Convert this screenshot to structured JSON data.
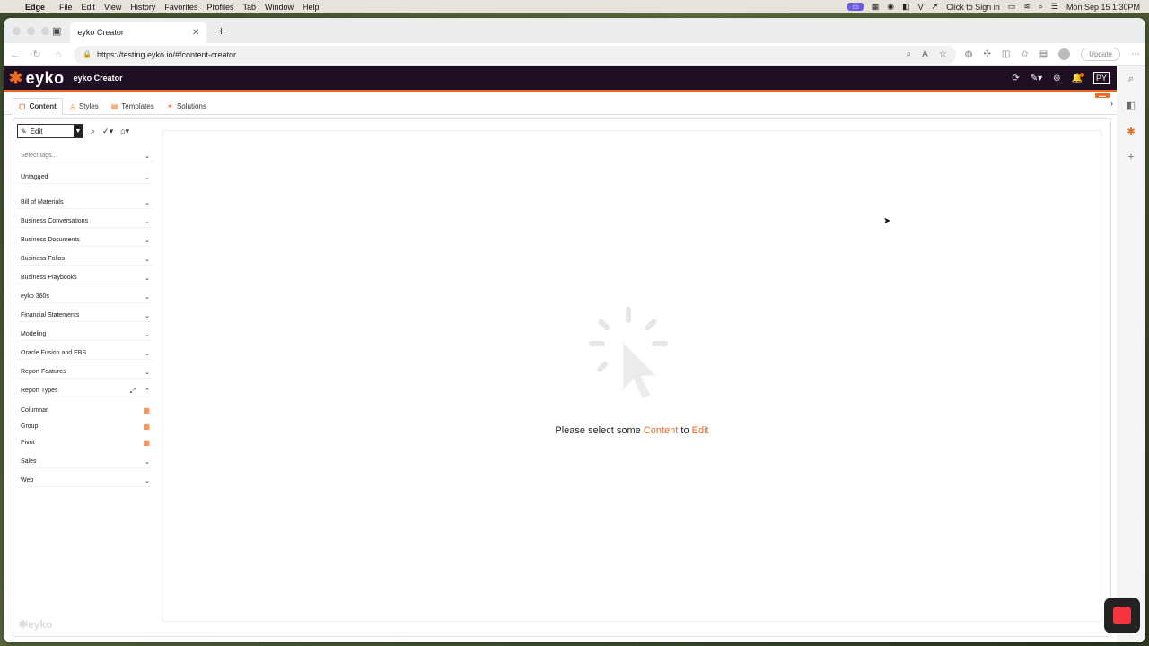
{
  "menubar": {
    "app": "Edge",
    "items": [
      "File",
      "Edit",
      "View",
      "History",
      "Favorites",
      "Profiles",
      "Tab",
      "Window",
      "Help"
    ],
    "sign_in": "Click to Sign in",
    "datetime": "Mon Sep 15  1:30PM"
  },
  "browser": {
    "tab_title": "eyko Creator",
    "url": "https://testing.eyko.io/#/content-creator",
    "update_label": "Update"
  },
  "app": {
    "logo_text": "eyko",
    "title": "eyko Creator",
    "user_initials": "PY",
    "accent_color": "#ea6a21"
  },
  "tabs": [
    {
      "label": "Content"
    },
    {
      "label": "Styles"
    },
    {
      "label": "Templates"
    },
    {
      "label": "Solutions"
    }
  ],
  "toolbar": {
    "edit_label": "Edit"
  },
  "sidebar": {
    "tag_placeholder": "Select tags...",
    "untagged": "Untagged",
    "categories": [
      {
        "label": "Bill of Materials"
      },
      {
        "label": "Business Conversations"
      },
      {
        "label": "Business Documents"
      },
      {
        "label": "Business Folios"
      },
      {
        "label": "Business Playbooks"
      },
      {
        "label": "eyko 360s"
      },
      {
        "label": "Financial Statements"
      },
      {
        "label": "Modeling"
      },
      {
        "label": "Oracle Fusion and EBS"
      },
      {
        "label": "Report Features"
      }
    ],
    "expanded": {
      "label": "Report Types",
      "children": [
        {
          "label": "Columnar"
        },
        {
          "label": "Group"
        },
        {
          "label": "Pivot"
        }
      ]
    },
    "after": [
      {
        "label": "Sales"
      },
      {
        "label": "Web"
      }
    ],
    "footer_logo": "eyko"
  },
  "editor": {
    "msg_prefix": "Please select some ",
    "msg_content": "Content",
    "msg_mid": " to ",
    "msg_edit": "Edit"
  }
}
